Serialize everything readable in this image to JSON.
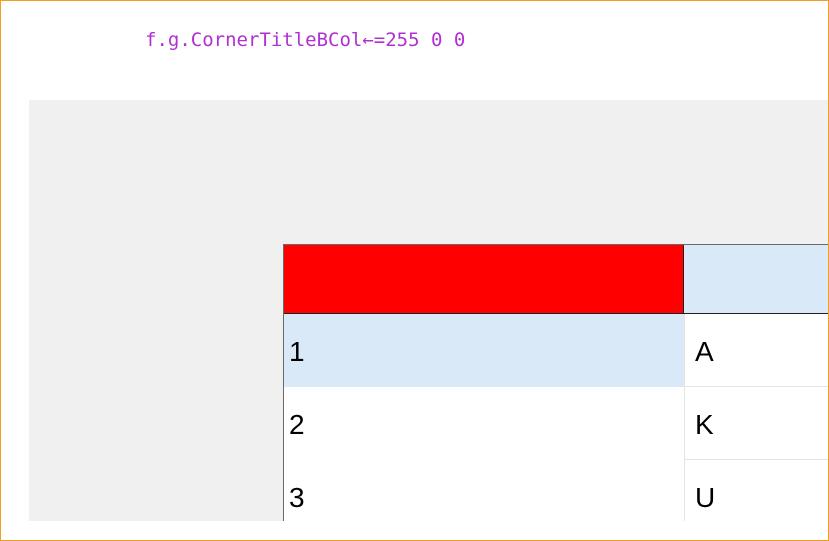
{
  "code": {
    "line": "f.g.CornerTitleBCol←=255 0 0"
  },
  "grid": {
    "corner_color": "#ff0000",
    "title_bg": "#d9e9f7",
    "rows": [
      {
        "title": "1",
        "value": "A"
      },
      {
        "title": "2",
        "value": "K"
      },
      {
        "title": "3",
        "value": "U"
      }
    ]
  }
}
